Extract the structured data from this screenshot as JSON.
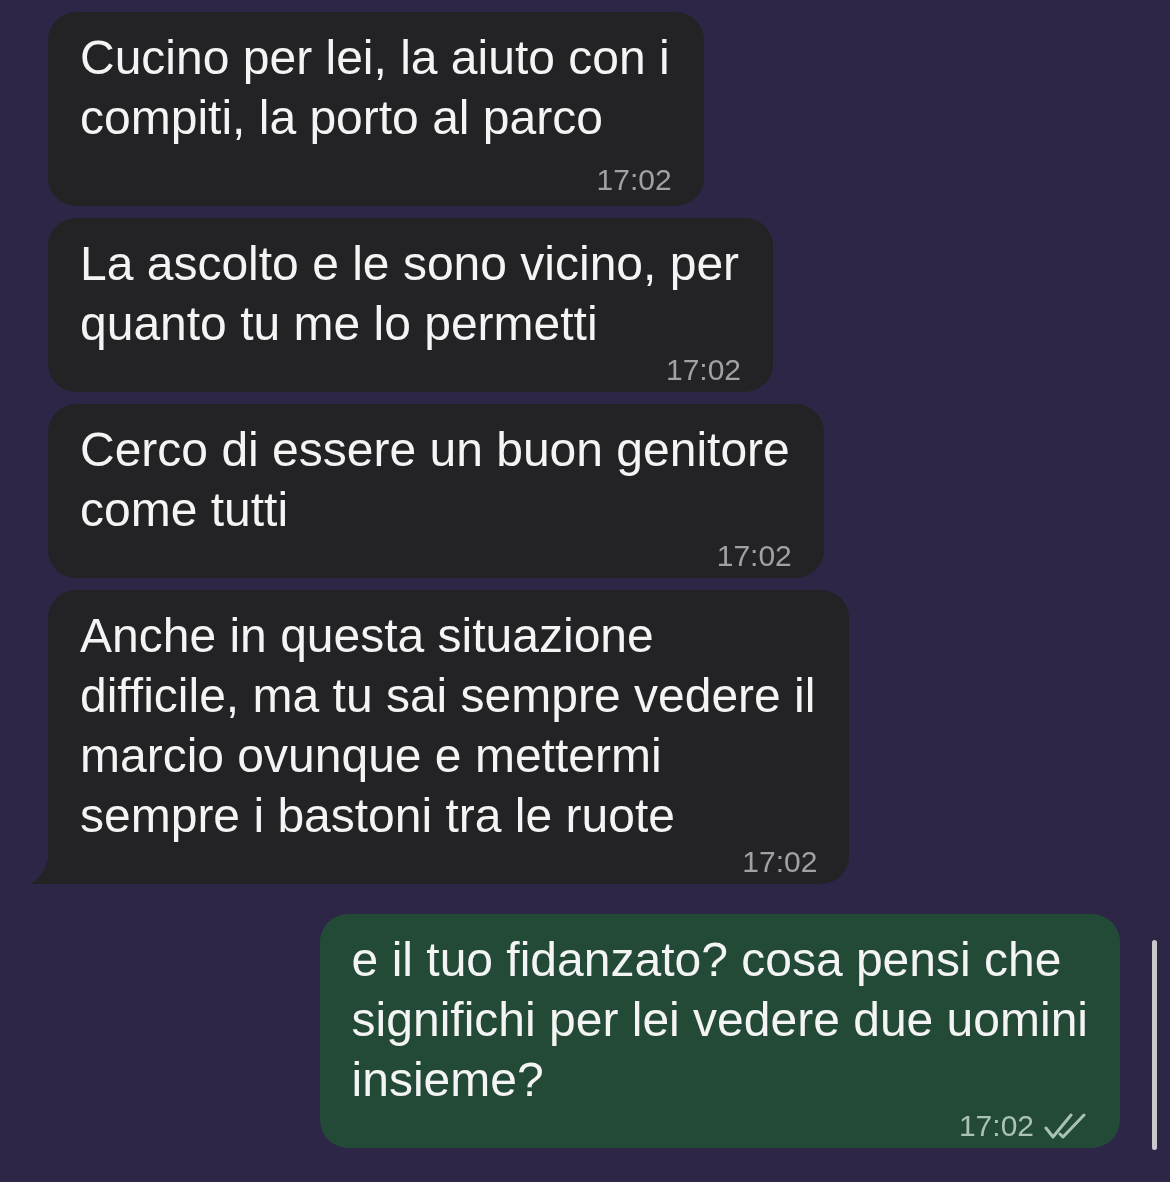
{
  "messages": [
    {
      "kind": "incoming",
      "text": "Cucino per lei, la aiuto con i\ncompiti, la porto al parco",
      "time": "17:02",
      "tail": false
    },
    {
      "kind": "incoming",
      "text": "La ascolto e le sono vicino, per\nquanto tu me lo permetti",
      "time": "17:02",
      "tail": false
    },
    {
      "kind": "incoming",
      "text": "Cerco di essere un buon genitore\ncome tutti",
      "time": "17:02",
      "tail": false
    },
    {
      "kind": "incoming",
      "text": "Anche in questa situazione\ndifficile, ma tu sai sempre vedere il\nmarcio ovunque e mettermi\nsempre i bastoni tra le ruote",
      "time": "17:02",
      "tail": true
    },
    {
      "kind": "outgoing",
      "text": "e il tuo fidanzato? cosa pensi che\nsignifichi per lei vedere due uomini\ninsieme?",
      "time": "17:02",
      "read": true,
      "tail": false
    }
  ]
}
